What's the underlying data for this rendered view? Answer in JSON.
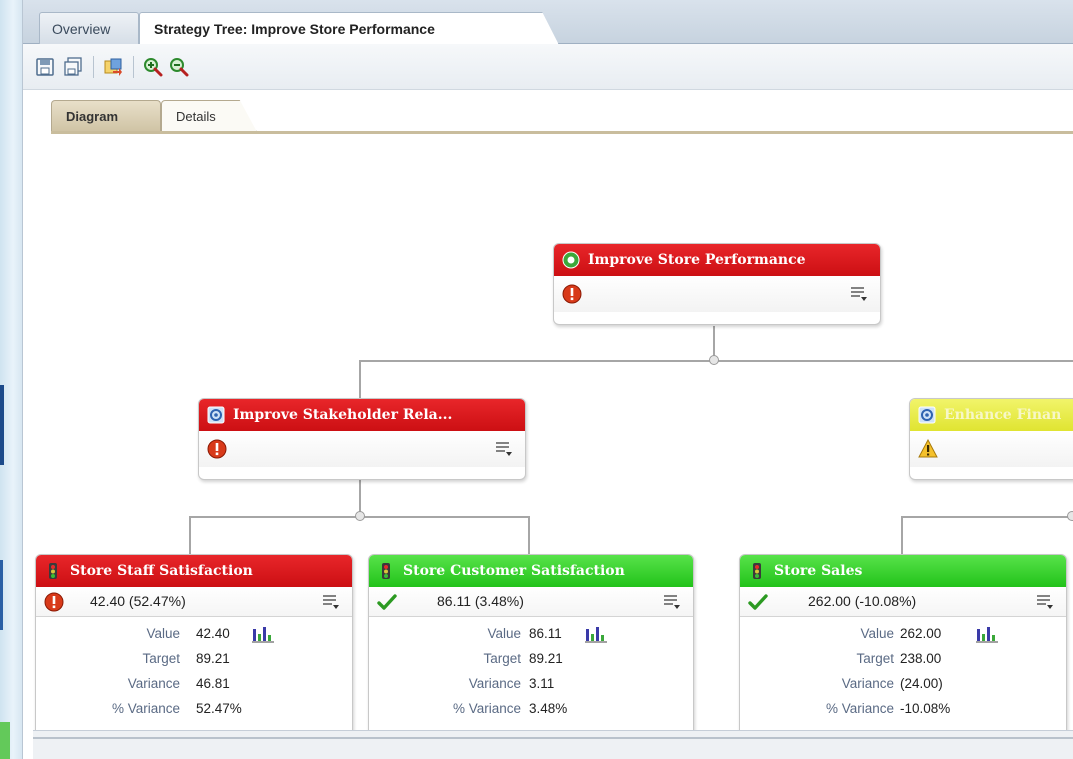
{
  "tabs": {
    "overview": "Overview",
    "strategy_tree": "Strategy Tree: Improve Store Performance"
  },
  "toolbar": {
    "icons": [
      "save-icon",
      "save-as-icon",
      "export-icon",
      "zoom-in-icon",
      "zoom-out-icon"
    ]
  },
  "view_tabs": {
    "diagram": "Diagram",
    "details": "Details"
  },
  "colors": {
    "status_red": "#d4141a",
    "status_green": "#2fcb25",
    "status_yellow": "#e6e93e",
    "label_blue": "#5a6a84"
  },
  "tree": {
    "root": {
      "title": "Improve Store Performance",
      "status": "critical"
    },
    "objective_left": {
      "title": "Improve Stakeholder Rela...",
      "status": "critical"
    },
    "objective_right": {
      "title": "Enhance Finan",
      "status": "warning"
    },
    "kpis": [
      {
        "title": "Store Staff Satisfaction",
        "status": "critical",
        "summary": "42.40 (52.47%)",
        "labels": {
          "value": "Value",
          "target": "Target",
          "variance": "Variance",
          "pct_variance": "% Variance"
        },
        "value": "42.40",
        "target": "89.21",
        "variance": "46.81",
        "pct_variance": "52.47%"
      },
      {
        "title": "Store Customer Satisfaction",
        "status": "ok",
        "summary": "86.11 (3.48%)",
        "labels": {
          "value": "Value",
          "target": "Target",
          "variance": "Variance",
          "pct_variance": "% Variance"
        },
        "value": "86.11",
        "target": "89.21",
        "variance": "3.11",
        "pct_variance": "3.48%"
      },
      {
        "title": "Store Sales",
        "status": "ok",
        "summary": "262.00 (-10.08%)",
        "labels": {
          "value": "Value",
          "target": "Target",
          "variance": "Variance",
          "pct_variance": "% Variance"
        },
        "value": "262.00",
        "target": "238.00",
        "variance": "(24.00)",
        "pct_variance": "-10.08%"
      }
    ]
  }
}
